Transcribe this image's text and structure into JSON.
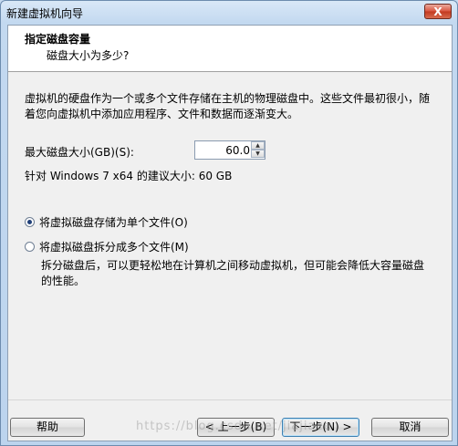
{
  "window": {
    "title": "新建虚拟机向导",
    "close_label": "X"
  },
  "header": {
    "title": "指定磁盘容量",
    "subtitle": "磁盘大小为多少?"
  },
  "description": "虚拟机的硬盘作为一个或多个文件存储在主机的物理磁盘中。这些文件最初很小，随着您向虚拟机中添加应用程序、文件和数据而逐渐变大。",
  "disk_size": {
    "label": "最大磁盘大小(GB)(S):",
    "value": "60.0",
    "up": "▲",
    "down": "▼"
  },
  "recommendation": "针对 Windows 7 x64 的建议大小: 60 GB",
  "options": {
    "single_file": {
      "label": "将虚拟磁盘存储为单个文件(O)",
      "checked": true
    },
    "multiple_files": {
      "label": "将虚拟磁盘拆分成多个文件(M)",
      "checked": false
    },
    "split_note": "拆分磁盘后，可以更轻松地在计算机之间移动虚拟机，但可能会降低大容量磁盘的性能。"
  },
  "buttons": {
    "help": "帮助",
    "back": "< 上一步(B)",
    "next": "下一步(N) >",
    "cancel": "取消"
  },
  "watermark": "https://blog.csdn.net/jiajiace"
}
